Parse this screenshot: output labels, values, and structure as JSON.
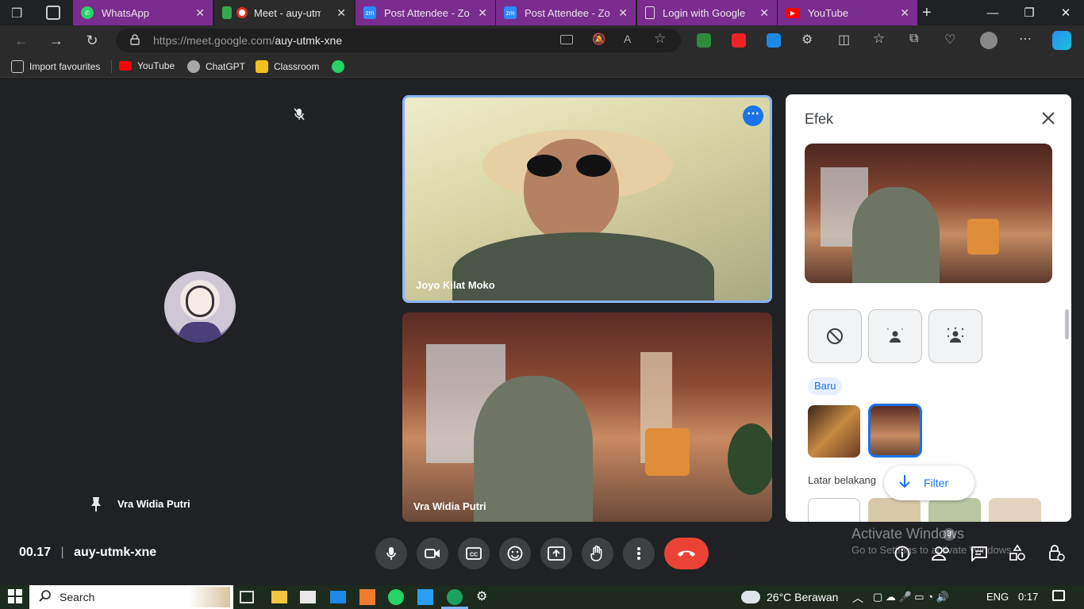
{
  "browser": {
    "tabs": [
      {
        "label": "WhatsApp",
        "icon": "whatsapp-icon"
      },
      {
        "label": "Meet - auy-utmk",
        "icon": "meet-icon"
      },
      {
        "label": "Post Attendee - Zoom",
        "icon": "zoom-icon"
      },
      {
        "label": "Post Attendee - Zoom",
        "icon": "zoom-icon"
      },
      {
        "label": "Login with Google -",
        "icon": "page-icon"
      },
      {
        "label": "YouTube",
        "icon": "youtube-icon"
      }
    ],
    "url_host": "https://meet.google.com/",
    "url_path": "auy-utmk-xne",
    "bookmarks": [
      {
        "label": "Import favourites"
      },
      {
        "label": "YouTube"
      },
      {
        "label": "ChatGPT"
      },
      {
        "label": "Classroom"
      },
      {
        "label": ""
      }
    ]
  },
  "meet": {
    "left_tile_name": "Vra Widia Putri",
    "tile1_name": "Joyo Kilat Moko",
    "tile2_name": "Vra Widia Putri",
    "meeting_time": "00.17",
    "meeting_code": "auy-utmk-xne",
    "participant_count": "3"
  },
  "panel": {
    "title": "Efek",
    "section_new": "Baru",
    "section_backgrounds": "Latar belakang",
    "filter_label": "Filter"
  },
  "watermark": {
    "line1": "Activate Windows",
    "line2": "Go to Settings to activate Windows."
  },
  "taskbar": {
    "search_placeholder": "Search",
    "weather": "26°C  Berawan",
    "language": "ENG",
    "clock": "0:17"
  },
  "colors": {
    "accent_blue": "#1a73e8",
    "end_call_red": "#ea4335",
    "tab_purple": "#7a2c8f"
  }
}
